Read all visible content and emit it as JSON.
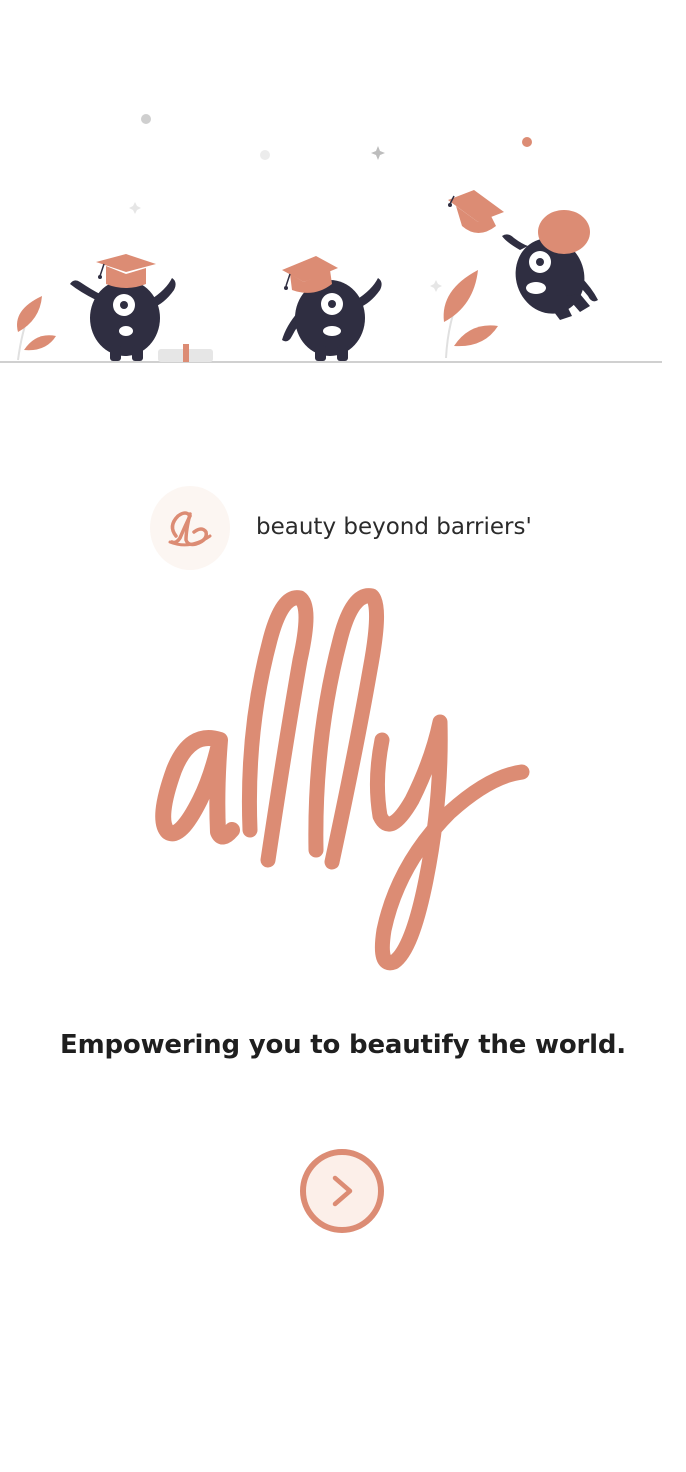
{
  "hero": {
    "illustration_name": "graduation-celebration-illustration",
    "characters": [
      "graduate-character-left",
      "graduate-character-middle",
      "graduate-character-jumping"
    ]
  },
  "brand": {
    "logo_monogram": "ab",
    "tagline": "beauty beyond barriers'",
    "wordmark": "ally"
  },
  "slogan": "Empowering you to beautify the world.",
  "next_button": {
    "icon": "chevron-right-icon"
  },
  "colors": {
    "accent": "#dc8c74",
    "accent_light": "#fcefe9",
    "character": "#2f2e41",
    "background": "#ffffff",
    "text": "#1f1f1f",
    "ground": "#cccccc"
  }
}
